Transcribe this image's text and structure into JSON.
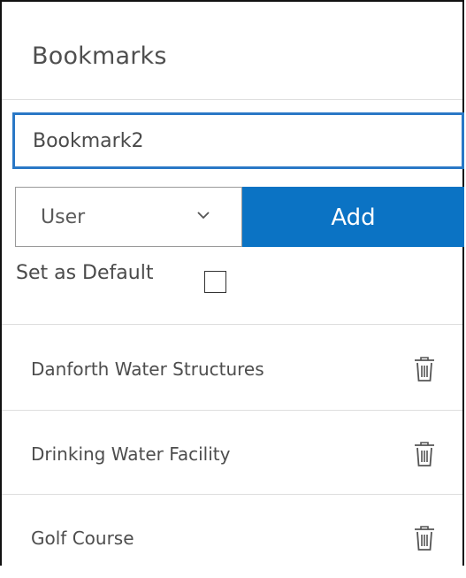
{
  "panel": {
    "title": "Bookmarks"
  },
  "form": {
    "name_value": "Bookmark2",
    "type_selected": "User",
    "add_label": "Add",
    "default_label": "Set as Default",
    "default_checked": false
  },
  "bookmarks": [
    {
      "label": "Danforth Water Structures"
    },
    {
      "label": "Drinking Water Facility"
    },
    {
      "label": "Golf Course"
    }
  ],
  "colors": {
    "accent": "#0b73c4",
    "input_border": "#2a78c6",
    "divider": "#dedede"
  },
  "icons": {
    "dropdown": "chevron-down-icon",
    "delete": "trash-icon"
  }
}
